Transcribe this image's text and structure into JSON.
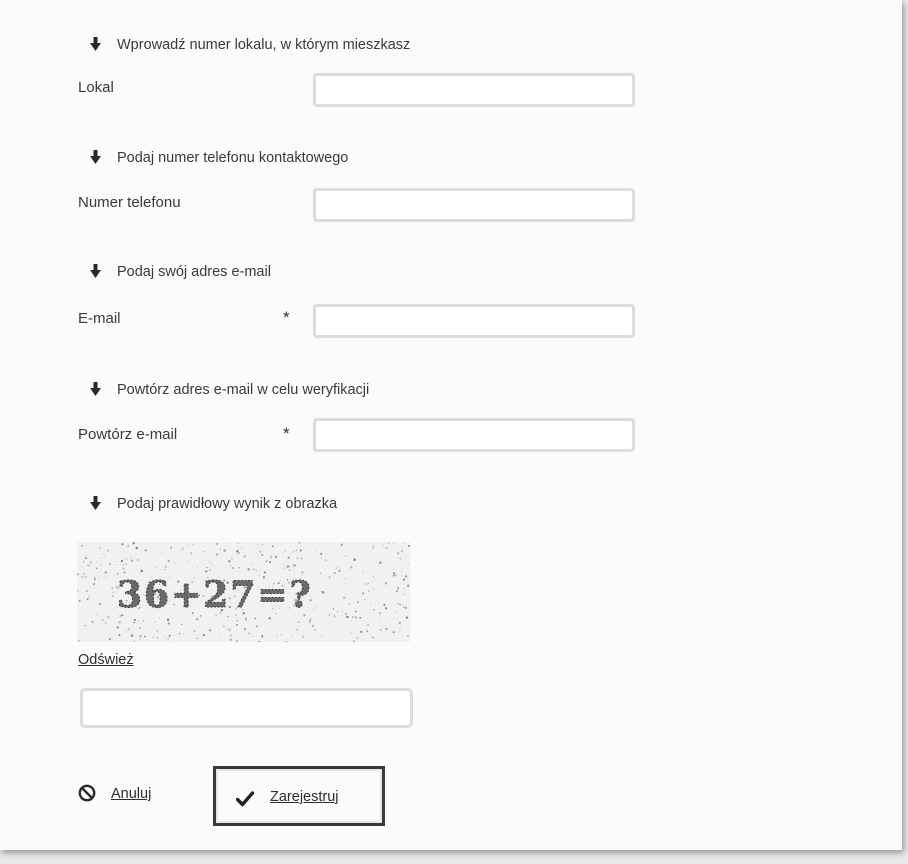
{
  "form": {
    "sections": [
      {
        "hint": "Wprowadź numer lokalu, w którym mieszkasz",
        "label": "Lokal",
        "required": false,
        "value": ""
      },
      {
        "hint": "Podaj numer telefonu kontaktowego",
        "label": "Numer telefonu",
        "required": false,
        "value": ""
      },
      {
        "hint": "Podaj swój adres e-mail",
        "label": "E-mail",
        "required": true,
        "value": ""
      },
      {
        "hint": "Powtórz adres e-mail w celu weryfikacji",
        "label": "Powtórz e-mail",
        "required": true,
        "value": ""
      }
    ],
    "required_marker": "*",
    "captcha": {
      "hint": "Podaj prawidłowy wynik z obrazka",
      "image_text": "36+27=?",
      "refresh_label": "Odśwież",
      "answer_value": ""
    },
    "actions": {
      "cancel_label": "Anuluj",
      "submit_label": "Zarejestruj"
    }
  },
  "icons": {
    "hint": "arrow-down-icon",
    "cancel": "ban-icon",
    "submit": "check-icon"
  }
}
